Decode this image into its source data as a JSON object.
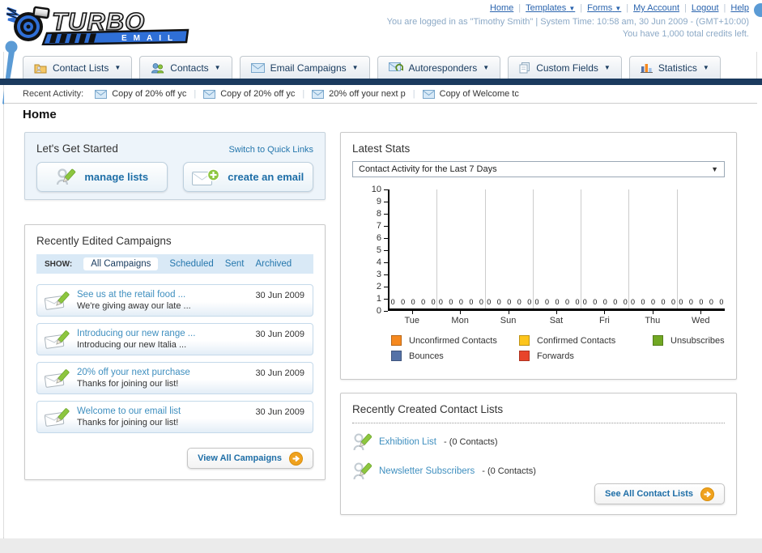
{
  "page": {
    "title": "Home"
  },
  "logo": {
    "line1": "TURBO",
    "line2": "EMAIL"
  },
  "topnav": {
    "links": [
      {
        "label": "Home",
        "dropdown": false
      },
      {
        "label": "Templates",
        "dropdown": true
      },
      {
        "label": "Forms",
        "dropdown": true
      },
      {
        "label": "My Account",
        "dropdown": false
      },
      {
        "label": "Logout",
        "dropdown": false
      },
      {
        "label": "Help",
        "dropdown": false
      }
    ],
    "login_info": "You are logged in as \"Timothy Smith\" | System Time: 10:58 am, 30 Jun 2009 - (GMT+10:00)",
    "credits_info": "You have 1,000 total credits left."
  },
  "tabs": [
    {
      "label": "Contact Lists",
      "icon": "folder-icon"
    },
    {
      "label": "Contacts",
      "icon": "contacts-icon"
    },
    {
      "label": "Email Campaigns",
      "icon": "envelope-icon"
    },
    {
      "label": "Autoresponders",
      "icon": "autoresponder-icon"
    },
    {
      "label": "Custom Fields",
      "icon": "pages-icon"
    },
    {
      "label": "Statistics",
      "icon": "bar-chart-icon"
    }
  ],
  "recent_activity": {
    "label": "Recent Activity:",
    "items": [
      "Copy of 20% off yc",
      "Copy of 20% off yc",
      "20% off your next p",
      "Copy of Welcome tc"
    ]
  },
  "get_started": {
    "title": "Let's Get Started",
    "switch_link": "Switch to Quick Links",
    "manage_lists_button": "manage lists",
    "create_email_button": "create an email"
  },
  "campaigns": {
    "title": "Recently Edited Campaigns",
    "show_label": "SHOW:",
    "filters": [
      "All Campaigns",
      "Scheduled",
      "Sent",
      "Archived"
    ],
    "active_filter": "All Campaigns",
    "items": [
      {
        "title": "See us at the retail food ...",
        "subtitle": "We're giving away our late ...",
        "date": "30 Jun 2009"
      },
      {
        "title": "Introducing our new range ...",
        "subtitle": "Introducing our new Italia ...",
        "date": "30 Jun 2009"
      },
      {
        "title": "20% off your next purchase",
        "subtitle": "Thanks for joining our list!",
        "date": "30 Jun 2009"
      },
      {
        "title": "Welcome to our email list",
        "subtitle": "Thanks for joining our list!",
        "date": "30 Jun 2009"
      }
    ],
    "view_all_button": "View All Campaigns"
  },
  "stats": {
    "title": "Latest Stats",
    "selected_option": "Contact Activity for the Last 7 Days"
  },
  "chart_data": {
    "type": "bar",
    "title": "Contact Activity for the Last 7 Days",
    "categories": [
      "Tue",
      "Mon",
      "Sun",
      "Sat",
      "Fri",
      "Thu",
      "Wed"
    ],
    "series": [
      {
        "name": "Unconfirmed Contacts",
        "color": "#F6891F",
        "values": [
          0,
          0,
          0,
          0,
          0,
          0,
          0
        ]
      },
      {
        "name": "Confirmed Contacts",
        "color": "#FDC51C",
        "values": [
          0,
          0,
          0,
          0,
          0,
          0,
          0
        ]
      },
      {
        "name": "Unsubscribes",
        "color": "#71A823",
        "values": [
          0,
          0,
          0,
          0,
          0,
          0,
          0
        ]
      },
      {
        "name": "Bounces",
        "color": "#5572A7",
        "values": [
          0,
          0,
          0,
          0,
          0,
          0,
          0
        ]
      },
      {
        "name": "Forwards",
        "color": "#E8442B",
        "values": [
          0,
          0,
          0,
          0,
          0,
          0,
          0
        ]
      }
    ],
    "ylim": [
      0,
      10
    ],
    "ytick_step": 1,
    "grid": true,
    "legend_position": "bottom",
    "value_labels_shown": true
  },
  "contact_lists": {
    "title": "Recently Created Contact Lists",
    "items": [
      {
        "name": "Exhibition List",
        "detail": "- (0 Contacts)"
      },
      {
        "name": "Newsletter Subscribers",
        "detail": "- (0 Contacts)"
      }
    ],
    "see_all_button": "See All Contact Lists"
  },
  "colors": {
    "navy_bar": "#1B3A5E",
    "link_blue": "#2A64AE",
    "teal_link": "#3F8FBF",
    "button_blue": "#1E6EA7",
    "accent_orange": "#F0A21E",
    "pin_blue": "#5B9BD5"
  }
}
